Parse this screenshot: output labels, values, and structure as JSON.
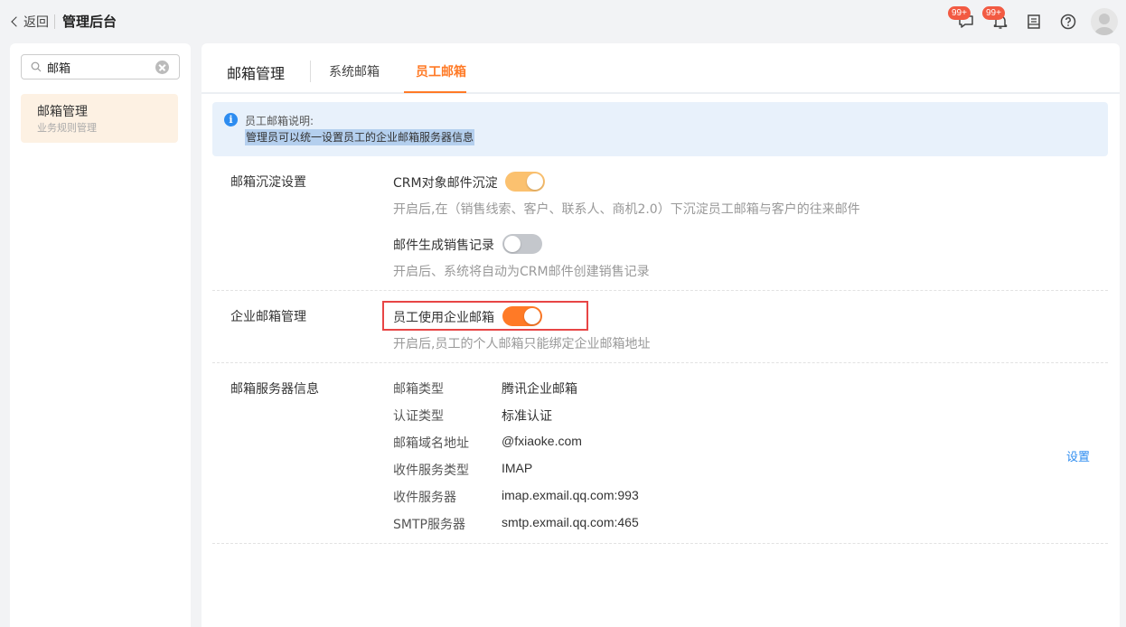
{
  "header": {
    "back_label": "返回",
    "title": "管理后台",
    "icons": [
      {
        "name": "chat-icon",
        "badge": "99+"
      },
      {
        "name": "bell-icon",
        "badge": "99+"
      },
      {
        "name": "inbox-icon"
      },
      {
        "name": "help-icon"
      },
      {
        "name": "avatar"
      }
    ],
    "accent_color": "#ff7a26",
    "badge_color": "#f25a42"
  },
  "sidebar": {
    "search": {
      "value": "邮箱",
      "placeholder": ""
    },
    "items": [
      {
        "title": "邮箱管理",
        "subtitle": "业务规则管理",
        "selected": true
      }
    ]
  },
  "main": {
    "title": "邮箱管理",
    "tabs": [
      {
        "label": "系统邮箱",
        "active": false
      },
      {
        "label": "员工邮箱",
        "active": true
      }
    ],
    "notice": {
      "title": "员工邮箱说明:",
      "body": "管理员可以统一设置员工的企业邮箱服务器信息"
    },
    "sections": {
      "sync": {
        "label": "邮箱沉淀设置",
        "options": [
          {
            "label": "CRM对象邮件沉淀",
            "enabled": true,
            "desc": "开启后,在（销售线索、客户、联系人、商机2.0）下沉淀员工邮箱与客户的往来邮件"
          },
          {
            "label": "邮件生成销售记录",
            "enabled": false,
            "desc": "开启后、系统将自动为CRM邮件创建销售记录"
          }
        ]
      },
      "enterprise": {
        "label": "企业邮箱管理",
        "options": [
          {
            "label": "员工使用企业邮箱",
            "enabled": true,
            "desc": "开启后,员工的个人邮箱只能绑定企业邮箱地址"
          }
        ]
      },
      "server": {
        "label": "邮箱服务器信息",
        "rows": [
          {
            "key": "邮箱类型",
            "value": "腾讯企业邮箱"
          },
          {
            "key": "认证类型",
            "value": "标准认证"
          },
          {
            "key": "邮箱域名地址",
            "value": "@fxiaoke.com"
          },
          {
            "key": "收件服务类型",
            "value": "IMAP"
          },
          {
            "key": "收件服务器",
            "value": "imap.exmail.qq.com:993"
          },
          {
            "key": "SMTP服务器",
            "value": "smtp.exmail.qq.com:465"
          }
        ],
        "action_label": "设置"
      }
    }
  }
}
